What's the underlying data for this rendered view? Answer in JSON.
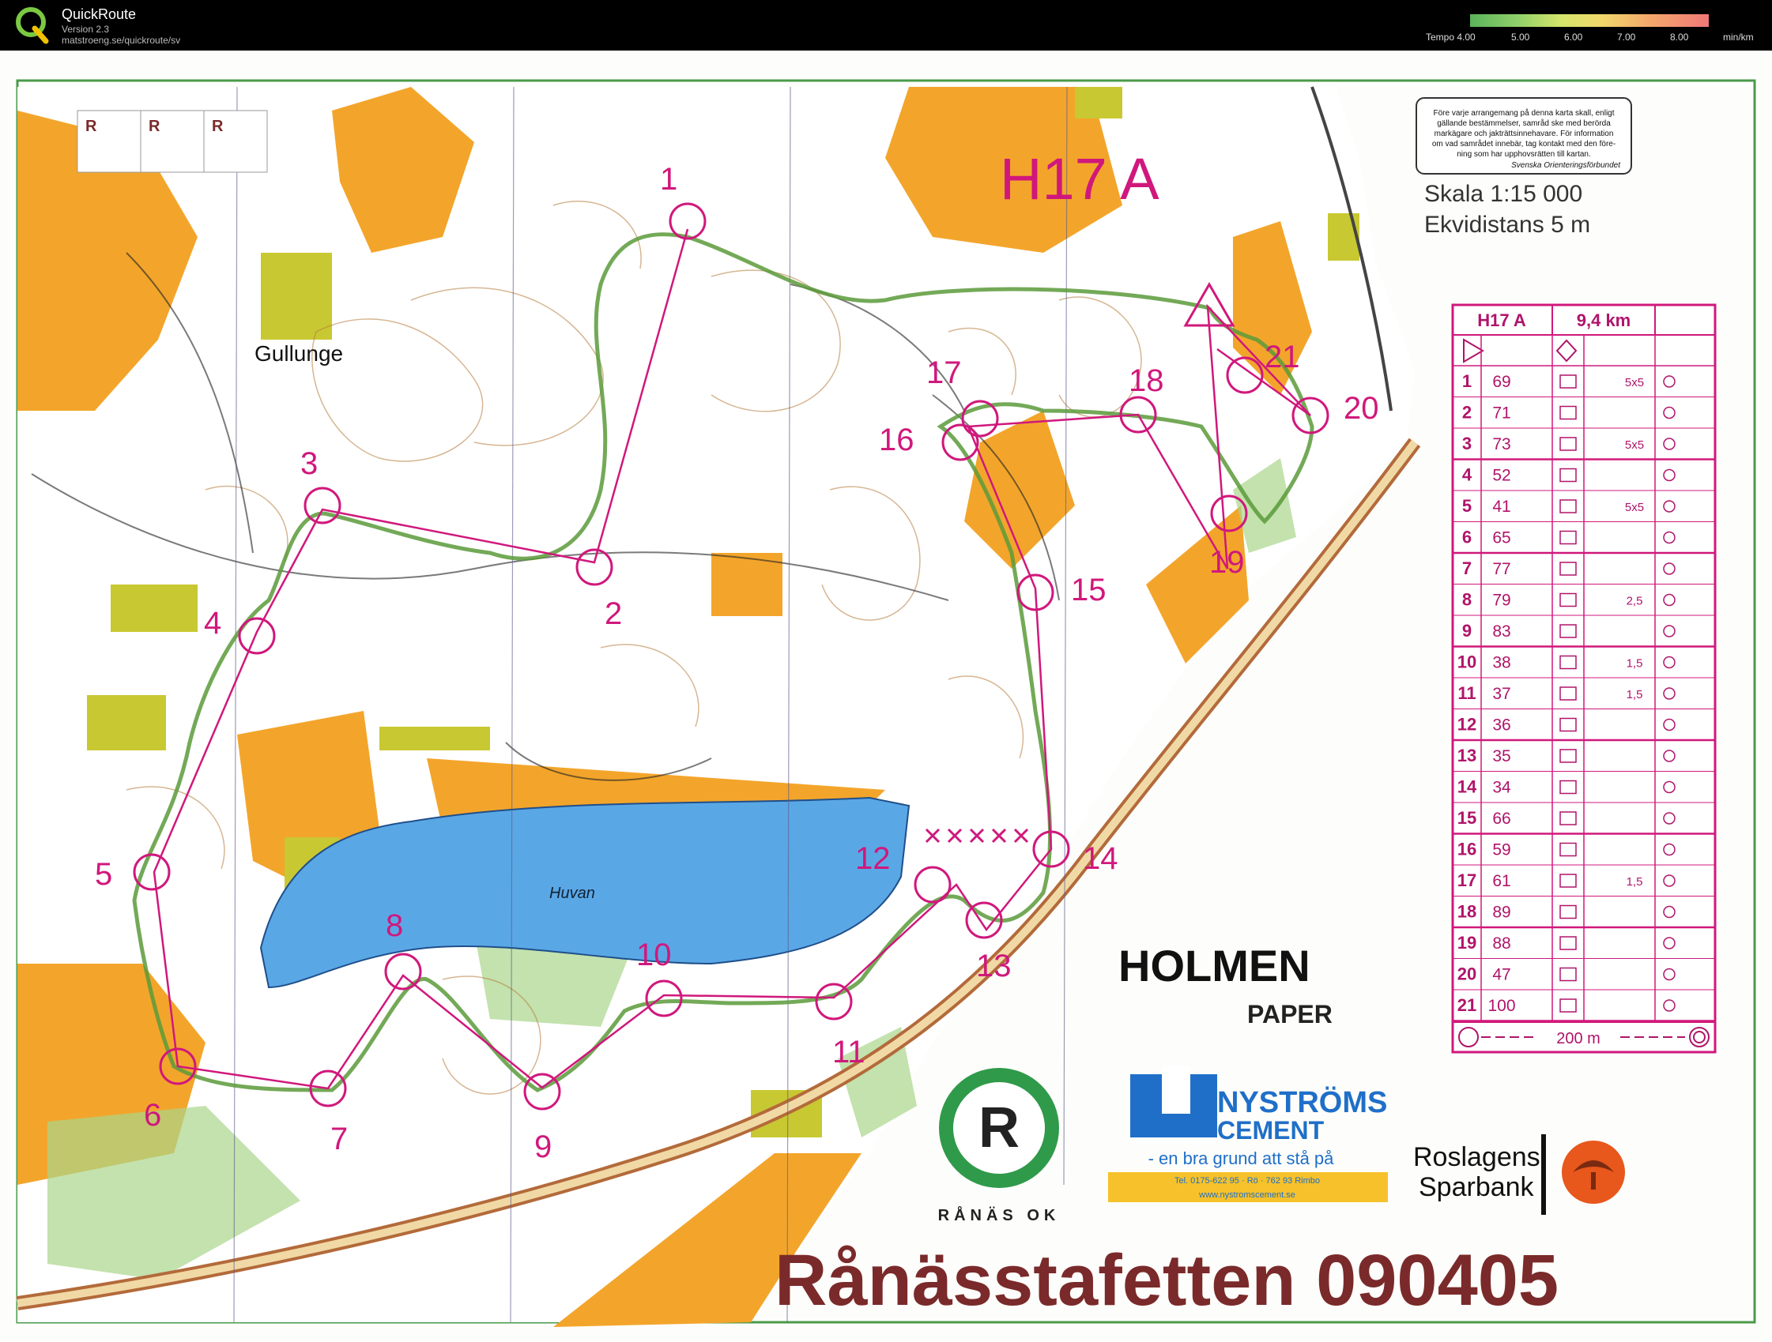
{
  "app": {
    "title": "QuickRoute",
    "version": "Version 2.3",
    "url": "matstroeng.se/quickroute/sv"
  },
  "pace_legend": {
    "label": "Tempo",
    "ticks": [
      "4.00",
      "5.00",
      "6.00",
      "7.00",
      "8.00"
    ],
    "unit": "min/km"
  },
  "map": {
    "class_title": "H17 A",
    "scale": "Skala 1:15 000",
    "equidistance": "Ekvidistans 5 m",
    "place_gullunge": "Gullunge",
    "lake_name": "Huvan",
    "permit_text": [
      "Före varje arrangemang på denna karta skall, enligt",
      "gällande bestämmelser, samråd ske med berörda",
      "markägare och jakträttsinnehavare. För information",
      "om vad samrådet innebär, tag kontakt med den före-",
      "ning som har upphovsrätten till kartan.",
      "Svenska Orienteringsförbundet"
    ],
    "r_boxes": [
      "R",
      "R",
      "R"
    ],
    "holmen": "HOLMEN",
    "paper": "PAPER",
    "sponsor_nystroms_1": "NYSTRÖMS",
    "sponsor_nystroms_2": "CEMENT",
    "sponsor_slogan": "- en bra grund att stå på",
    "sponsor_contact": "Tel. 0175-622 95 · Rö · 762 93 Rimbo",
    "sponsor_web": "www.nystromscement.se",
    "bank_1": "Roslagens",
    "bank_2": "Sparbank",
    "club_ring": "RÅNÄS OK",
    "event_title": "Rånässtafetten 090405",
    "controls": [
      "1",
      "2",
      "3",
      "4",
      "5",
      "6",
      "7",
      "8",
      "9",
      "10",
      "11",
      "12",
      "13",
      "14",
      "15",
      "16",
      "17",
      "18",
      "19",
      "20",
      "21"
    ]
  },
  "description_sheet": {
    "class": "H17 A",
    "length": "9,4 km",
    "rows": [
      {
        "n": "1",
        "code": "69",
        "dim": "5x5"
      },
      {
        "n": "2",
        "code": "71",
        "dim": ""
      },
      {
        "n": "3",
        "code": "73",
        "dim": "5x5"
      },
      {
        "n": "4",
        "code": "52",
        "dim": ""
      },
      {
        "n": "5",
        "code": "41",
        "dim": "5x5"
      },
      {
        "n": "6",
        "code": "65",
        "dim": ""
      },
      {
        "n": "7",
        "code": "77",
        "dim": ""
      },
      {
        "n": "8",
        "code": "79",
        "dim": "2,5"
      },
      {
        "n": "9",
        "code": "83",
        "dim": ""
      },
      {
        "n": "10",
        "code": "38",
        "dim": "1,5"
      },
      {
        "n": "11",
        "code": "37",
        "dim": "1,5"
      },
      {
        "n": "12",
        "code": "36",
        "dim": ""
      },
      {
        "n": "13",
        "code": "35",
        "dim": ""
      },
      {
        "n": "14",
        "code": "34",
        "dim": ""
      },
      {
        "n": "15",
        "code": "66",
        "dim": ""
      },
      {
        "n": "16",
        "code": "59",
        "dim": ""
      },
      {
        "n": "17",
        "code": "61",
        "dim": "1,5"
      },
      {
        "n": "18",
        "code": "89",
        "dim": ""
      },
      {
        "n": "19",
        "code": "88",
        "dim": ""
      },
      {
        "n": "20",
        "code": "47",
        "dim": ""
      },
      {
        "n": "21",
        "code": "100",
        "dim": ""
      }
    ],
    "finish": "200 m"
  },
  "colors": {
    "control": "#d0187c",
    "route": "#5a9a3a",
    "forest_open": "#f3a52b",
    "lake": "#5aa7e6",
    "text_brown": "#7a2a2a"
  }
}
